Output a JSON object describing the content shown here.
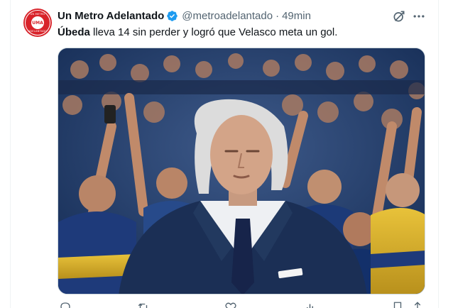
{
  "tweet": {
    "display_name": "Un Metro Adelantado",
    "handle": "@metroadelantado",
    "separator": "·",
    "time": "49min",
    "text_bold": "Úbeda",
    "text_rest": " lleva 14 sin perder y logró que Velasco meta un gol.",
    "verified": true
  },
  "avatar": {
    "text_top": "UN METRO",
    "text_center": "UMA",
    "text_bottom": "ADELANTADO",
    "color": "#d8232a"
  },
  "icons": {
    "verified": "verified-badge-icon",
    "grok": "grok-icon",
    "more": "more-icon",
    "reply": "reply-icon",
    "retweet": "retweet-icon",
    "like": "like-icon",
    "views": "views-icon",
    "bookmark": "bookmark-icon",
    "share": "share-icon"
  },
  "colors": {
    "accent": "#1d9bf0",
    "text": "#0f1419",
    "muted": "#536471",
    "border": "#cfd9de"
  }
}
